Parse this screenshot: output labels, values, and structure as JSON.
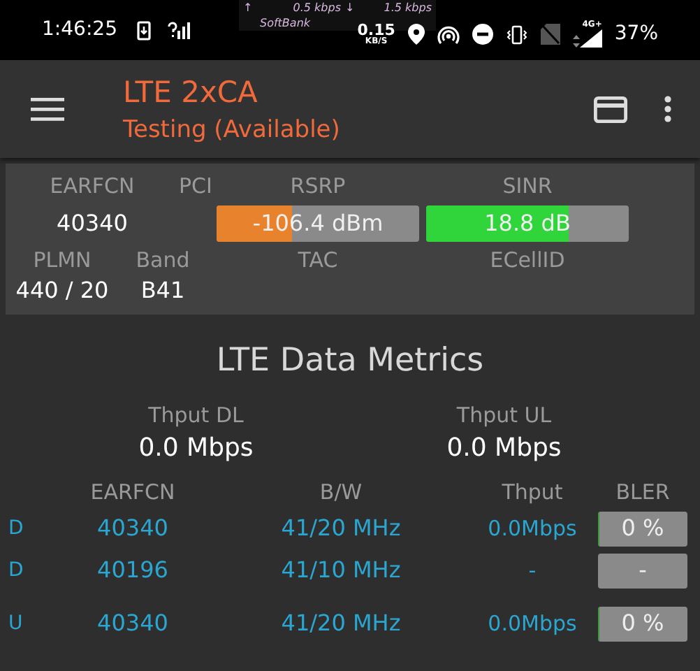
{
  "status_bar": {
    "time": "1:46:25",
    "up_arrow": "↑",
    "down_arrow": "↓",
    "up_rate": "0.5 kbps",
    "down_rate": "1.5 kbps",
    "carrier": "SoftBank",
    "speed": "0.15",
    "speed_unit": "KB/S",
    "network": "4G+",
    "battery": "37%"
  },
  "app_bar": {
    "title": "LTE 2xCA",
    "subtitle": "Testing (Available)"
  },
  "cell": {
    "top_labels": [
      "EARFCN",
      "PCI",
      "RSRP",
      "SINR"
    ],
    "earfcn": "40340",
    "rsrp": {
      "reading": "-106.4 dBm",
      "level": 0.37,
      "color": "#e8822c"
    },
    "sinr": {
      "reading": "18.8 dB",
      "level": 0.7,
      "color": "#2fd53a"
    },
    "bottom_labels": [
      "PLMN",
      "Band",
      "TAC",
      "ECellID"
    ],
    "plmn": "440 / 20",
    "band": "B41"
  },
  "metrics": {
    "title": "LTE Data Metrics",
    "thput_dl_label": "Thput DL",
    "thput_dl": "0.0 Mbps",
    "thput_ul_label": "Thput UL",
    "thput_ul": "0.0 Mbps",
    "columns": [
      "EARFCN",
      "B/W",
      "Thput",
      "BLER"
    ],
    "rows": [
      {
        "dir": "D",
        "earfcn": "40340",
        "bw": "41/20 MHz",
        "thput": "0.0Mbps",
        "bler": "0 %",
        "level": 0.02
      },
      {
        "dir": "D",
        "earfcn": "40196",
        "bw": "41/10 MHz",
        "thput": "-",
        "bler": "-"
      },
      {
        "dir": "U",
        "earfcn": "40340",
        "bw": "41/20 MHz",
        "thput": "0.0Mbps",
        "bler": "0 %",
        "level": 0.02
      }
    ]
  }
}
